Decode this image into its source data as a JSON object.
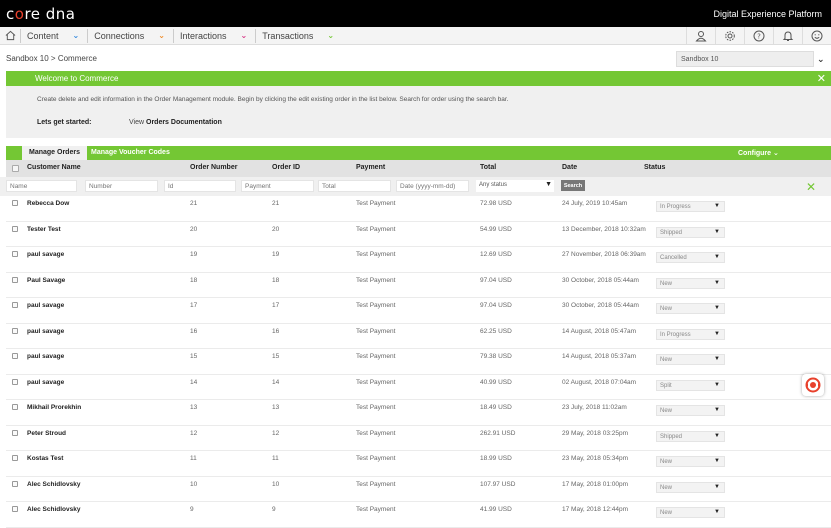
{
  "brand": {
    "logo_left": "c",
    "logo_dot": "o",
    "logo_right": "re dna",
    "platform": "Digital Experience Platform"
  },
  "nav": {
    "items": [
      {
        "label": "Content",
        "chevron_color": "#2e86de"
      },
      {
        "label": "Connections",
        "chevron_color": "#f08a24"
      },
      {
        "label": "Interactions",
        "chevron_color": "#d63384"
      },
      {
        "label": "Transactions",
        "chevron_color": "#74c734"
      }
    ],
    "icons": [
      "user-icon",
      "gear-icon",
      "help-icon",
      "bell-icon",
      "smiley-icon"
    ]
  },
  "breadcrumb": "Sandbox 10 > Commerce",
  "site_selector": {
    "value": "Sandbox 10"
  },
  "welcome": {
    "title": "Welcome to Commerce",
    "text": "Create delete and edit information in the Order Management module. Begin by clicking the edit existing order in the list below. Search for order using the search bar.",
    "start_label": "Lets get started:",
    "view_label": "View",
    "doc_link": "Orders Documentation"
  },
  "tabs": {
    "active": "Manage Orders",
    "other": "Manage Voucher Codes",
    "configure": "Configure"
  },
  "columns": {
    "customer": "Customer Name",
    "number": "Order Number",
    "id": "Order ID",
    "payment": "Payment",
    "total": "Total",
    "date": "Date",
    "status": "Status"
  },
  "filters": {
    "name": "Name",
    "number": "Number",
    "id": "Id",
    "payment": "Payment",
    "total": "Total",
    "date": "Date (yyyy-mm-dd)",
    "status_select": "Any status",
    "search_button": "Search"
  },
  "orders": [
    {
      "name": "Rebecca Dow",
      "number": "21",
      "id": "21",
      "payment": "Test Payment",
      "total": "72.98 USD",
      "date": "24 July, 2019 10:45am",
      "status": "In Progress"
    },
    {
      "name": "Tester Test",
      "number": "20",
      "id": "20",
      "payment": "Test Payment",
      "total": "54.99 USD",
      "date": "13 December, 2018 10:32am",
      "status": "Shipped"
    },
    {
      "name": "paul savage",
      "number": "19",
      "id": "19",
      "payment": "Test Payment",
      "total": "12.69 USD",
      "date": "27 November, 2018 06:39am",
      "status": "Cancelled"
    },
    {
      "name": "Paul Savage",
      "number": "18",
      "id": "18",
      "payment": "Test Payment",
      "total": "97.04 USD",
      "date": "30 October, 2018 05:44am",
      "status": "New"
    },
    {
      "name": "paul savage",
      "number": "17",
      "id": "17",
      "payment": "Test Payment",
      "total": "97.04 USD",
      "date": "30 October, 2018 05:44am",
      "status": "New"
    },
    {
      "name": "paul savage",
      "number": "16",
      "id": "16",
      "payment": "Test Payment",
      "total": "62.25 USD",
      "date": "14 August, 2018 05:47am",
      "status": "In Progress"
    },
    {
      "name": "paul savage",
      "number": "15",
      "id": "15",
      "payment": "Test Payment",
      "total": "79.38 USD",
      "date": "14 August, 2018 05:37am",
      "status": "New"
    },
    {
      "name": "paul savage",
      "number": "14",
      "id": "14",
      "payment": "Test Payment",
      "total": "40.99 USD",
      "date": "02 August, 2018 07:04am",
      "status": "Split"
    },
    {
      "name": "Mikhail Prorekhin",
      "number": "13",
      "id": "13",
      "payment": "Test Payment",
      "total": "18.49 USD",
      "date": "23 July, 2018 11:02am",
      "status": "New"
    },
    {
      "name": "Peter Stroud",
      "number": "12",
      "id": "12",
      "payment": "Test Payment",
      "total": "262.91 USD",
      "date": "29 May, 2018 03:25pm",
      "status": "Shipped"
    },
    {
      "name": "Kostas Test",
      "number": "11",
      "id": "11",
      "payment": "Test Payment",
      "total": "18.99 USD",
      "date": "23 May, 2018 05:34pm",
      "status": "New"
    },
    {
      "name": "Alec Schidlovsky",
      "number": "10",
      "id": "10",
      "payment": "Test Payment",
      "total": "107.97 USD",
      "date": "17 May, 2018 01:00pm",
      "status": "New"
    },
    {
      "name": "Alec Schidlovsky",
      "number": "9",
      "id": "9",
      "payment": "Test Payment",
      "total": "41.99 USD",
      "date": "17 May, 2018 12:44pm",
      "status": "New"
    }
  ],
  "colors": {
    "accent_green": "#74c734",
    "brand_red": "#e8412c"
  }
}
